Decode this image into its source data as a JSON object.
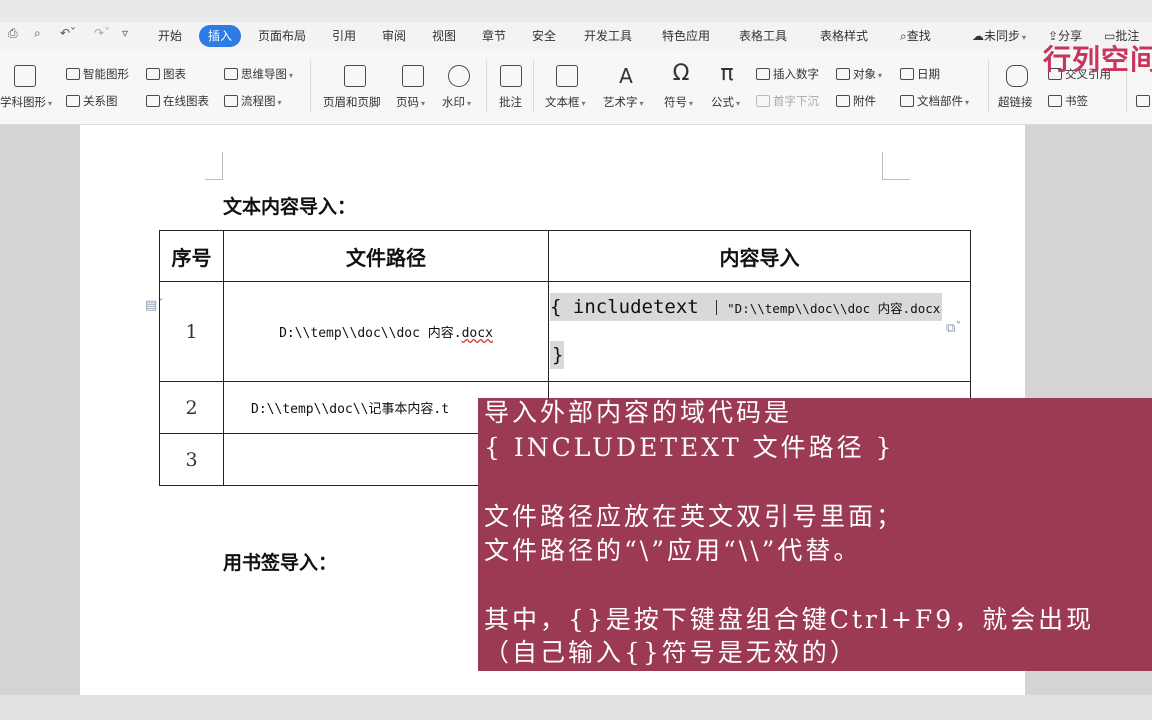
{
  "menubar": {
    "tabs": [
      "开始",
      "插入",
      "页面布局",
      "引用",
      "审阅",
      "视图",
      "章节",
      "安全",
      "开发工具",
      "特色应用",
      "表格工具",
      "表格样式"
    ],
    "active_tab": "插入",
    "search_label": "查找",
    "sync_label": "未同步",
    "share_label": "分享",
    "comment_label": "批注"
  },
  "ribbon": {
    "shapes_label": "学科图形",
    "smart_graphic": "智能图形",
    "chart": "图表",
    "mindmap": "思维导图",
    "relation": "关系图",
    "online_chart": "在线图表",
    "flowchart": "流程图",
    "header_footer": "页眉和页脚",
    "page_number": "页码",
    "watermark": "水印",
    "comment": "批注",
    "textbox": "文本框",
    "art_text": "艺术字",
    "symbol": "符号",
    "formula": "公式",
    "insert_number": "插入数字",
    "object": "对象",
    "date": "日期",
    "drop_cap": "首字下沉",
    "attachment": "附件",
    "doc_parts": "文档部件",
    "hyperlink": "超链接",
    "bookmark": "书签",
    "cross_ref": "交叉引用"
  },
  "document": {
    "heading1": "文本内容导入：",
    "heading2": "用书签导入：",
    "table": {
      "headers": [
        "序号",
        "文件路径",
        "内容导入"
      ],
      "rows": [
        {
          "num": "1",
          "path_prefix": "D:\\\\temp\\\\doc\\\\doc 内容.",
          "path_ext": "docx"
        },
        {
          "num": "2",
          "path_prefix": "D:\\\\temp\\\\doc\\\\记事本内容.t",
          "path_ext": ""
        },
        {
          "num": "3",
          "path_prefix": "",
          "path_ext": ""
        }
      ],
      "field_open": "{ includetext ",
      "field_path": "\"D:\\\\temp\\\\doc\\\\doc 内容.docx",
      "field_close": "}"
    }
  },
  "overlay": {
    "lines": [
      "导入外部内容的域代码是",
      "{ INCLUDETEXT 文件路径 }",
      "",
      "文件路径应放在英文双引号里面；",
      "文件路径的“\\”应用“\\\\”代替。",
      "",
      "其中，{}是按下键盘组合键Ctrl+F9，就会出现",
      "（自己输入{}符号是无效的）"
    ]
  },
  "watermark_text": "行列空间",
  "colors": {
    "accent": "#2d7be5",
    "overlay": "#9b3a52",
    "field_shade": "#d9d9d9"
  }
}
